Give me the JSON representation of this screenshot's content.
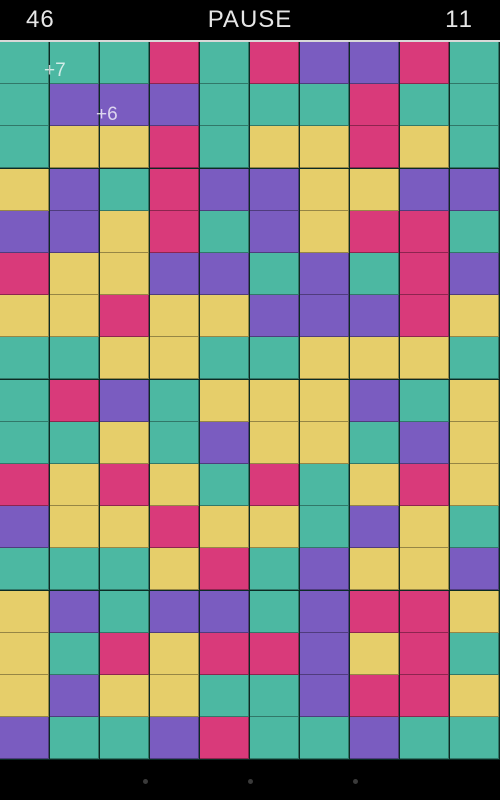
{
  "hud": {
    "score": "46",
    "pause_label": "PAUSE",
    "timer": "11"
  },
  "colors": {
    "T": "#4cb8a2",
    "Y": "#e6ce6a",
    "P": "#d93a7a",
    "V": "#7a5cc0"
  },
  "board": {
    "rows": [
      "TTTPTPVVPT",
      "TVVVTTTPTT",
      "TYYPTYYPYT",
      "YVTPVVYYVV",
      "VVYPTVYPPT",
      "PYYVVTVTPV",
      "YYPYYVVVPY",
      "TTYYTTYYYT",
      "TPVTYYYVTY",
      "TTYTVYYTVY",
      "PYPYTPTYPY",
      "VYYPYYTVYT",
      "TTTYPTVYYV",
      "YVTVVTVPPY",
      "YTPYPPVYPT",
      "YVYYTTVPPY",
      "VTTVPTTVTT"
    ]
  },
  "floats": [
    {
      "text": "+7"
    },
    {
      "text": "+6"
    }
  ]
}
